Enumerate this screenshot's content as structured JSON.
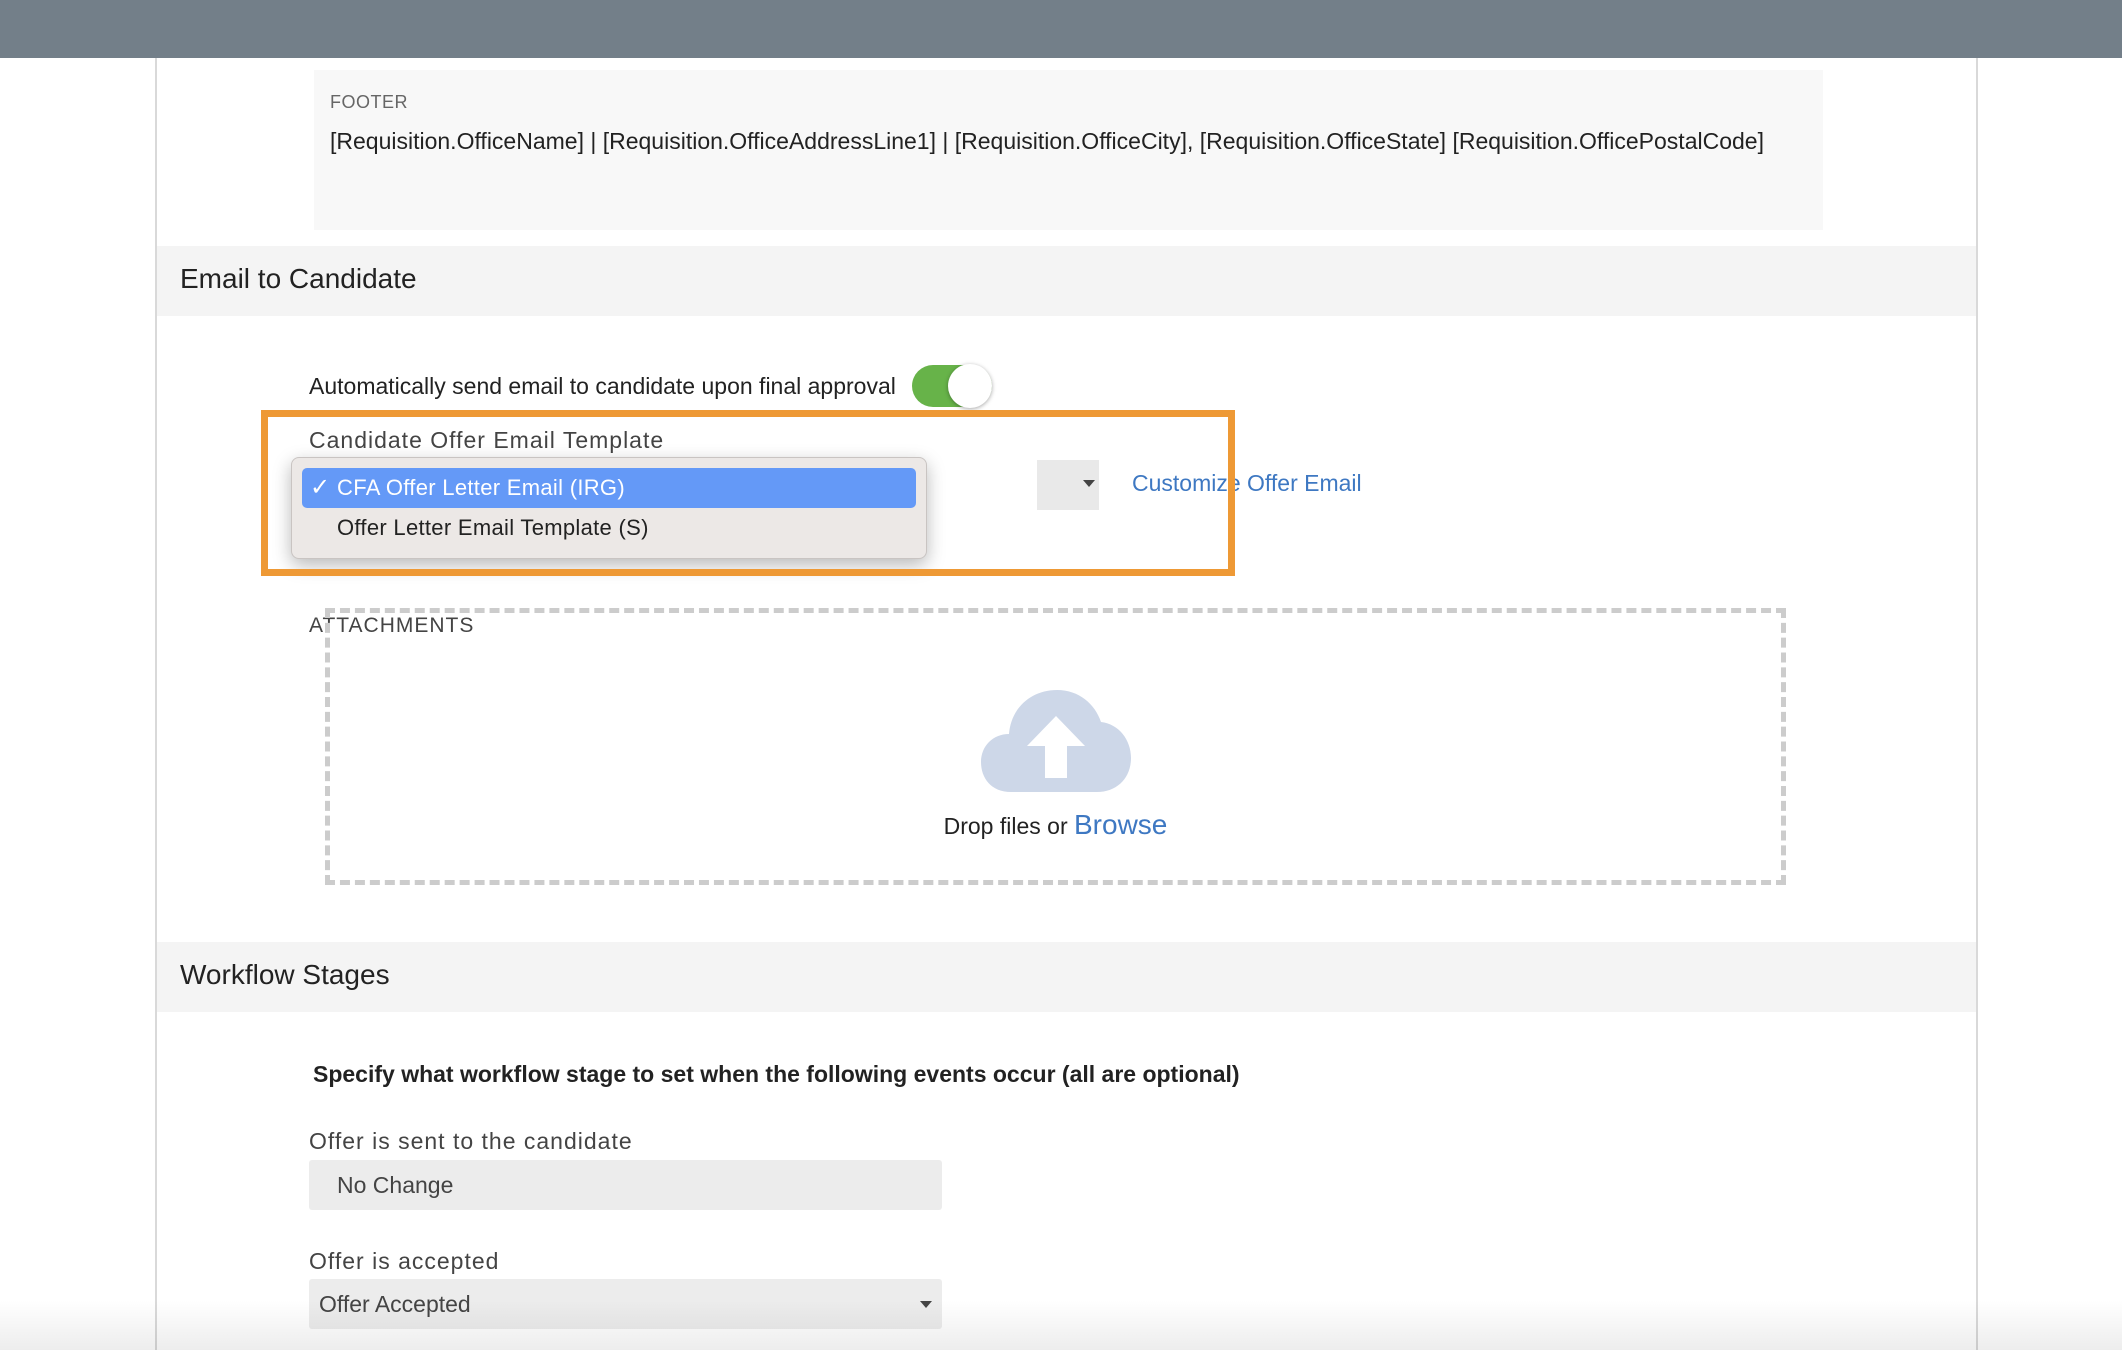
{
  "footer": {
    "label": "FOOTER",
    "text": "[Requisition.OfficeName] | [Requisition.OfficeAddressLine1] | [Requisition.OfficeCity], [Requisition.OfficeState] [Requisition.OfficePostalCode]"
  },
  "email_section": {
    "title": "Email to Candidate",
    "auto_send_label": "Automatically send email to candidate upon final approval",
    "auto_send_enabled": true,
    "template_label": "Candidate Offer Email Template",
    "template_options": [
      {
        "label": "CFA Offer Letter Email (IRG)",
        "selected": true
      },
      {
        "label": "Offer Letter Email Template (S)",
        "selected": false
      }
    ],
    "check_glyph": "✓",
    "customize_link": "Customize Offer Email",
    "attachments_label": "ATTACHMENTS",
    "dropzone": {
      "icon": "cloud-upload-icon",
      "text": "Drop files or",
      "browse": "Browse"
    }
  },
  "workflow_section": {
    "title": "Workflow Stages",
    "instruction": "Specify what workflow stage to set when the following events occur (all are optional)",
    "fields": [
      {
        "label": "Offer is sent to the candidate",
        "value": "No Change"
      },
      {
        "label": "Offer is accepted",
        "value": "Offer Accepted"
      }
    ]
  },
  "colors": {
    "topbar": "#737f89",
    "toggle_on": "#67b349",
    "highlight": "#ee9935",
    "link": "#3e78c2",
    "selected_option": "#6499f7"
  }
}
